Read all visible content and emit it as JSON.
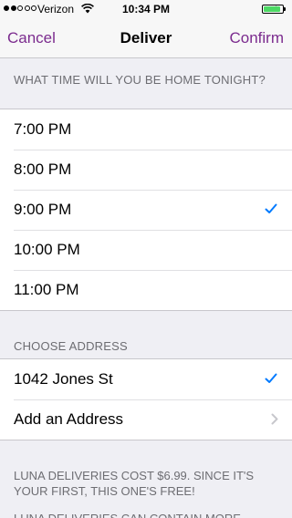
{
  "status_bar": {
    "carrier": "Verizon",
    "time": "10:34 PM",
    "signal_bars_filled": 2,
    "signal_bars_total": 5,
    "battery_level": 0.9,
    "icons": [
      "wifi-icon",
      "battery-icon",
      "charging-icon"
    ]
  },
  "nav": {
    "cancel_label": "Cancel",
    "title": "Deliver",
    "confirm_label": "Confirm",
    "accent_color": "#7b2b8e"
  },
  "time_section": {
    "header": "WHAT TIME WILL YOU BE HOME TONIGHT?",
    "options": [
      {
        "label": "7:00 PM",
        "selected": false
      },
      {
        "label": "8:00 PM",
        "selected": false
      },
      {
        "label": "9:00 PM",
        "selected": true
      },
      {
        "label": "10:00 PM",
        "selected": false
      },
      {
        "label": "11:00 PM",
        "selected": false
      }
    ]
  },
  "address_section": {
    "header": "CHOOSE ADDRESS",
    "selected_address": "1042 Jones St",
    "add_label": "Add an Address"
  },
  "footer": {
    "note": "LUNA DELIVERIES COST $6.99. SINCE IT'S YOUR FIRST, THIS ONE'S FREE!",
    "note_partial": "LUNA DELIVERIES CAN CONTAIN MORE"
  },
  "colors": {
    "checkmark": "#007aff",
    "background": "#efeff4",
    "battery": "#4cd964"
  }
}
